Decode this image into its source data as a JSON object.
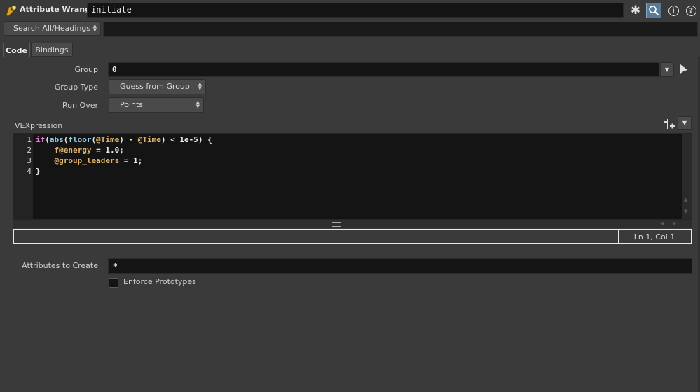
{
  "header": {
    "node_type": "Attribute Wrangle",
    "node_name": "initiate",
    "icons": [
      "node-wrangle-icon",
      "gear-icon",
      "search-icon",
      "info-icon",
      "help-icon"
    ]
  },
  "search": {
    "mode": "Search All/Headings",
    "value": ""
  },
  "tabs": [
    {
      "label": "Code",
      "active": true
    },
    {
      "label": "Bindings",
      "active": false
    }
  ],
  "params": {
    "group_label": "Group",
    "group_value": "0",
    "group_type_label": "Group Type",
    "group_type_value": "Guess from Group",
    "run_over_label": "Run Over",
    "run_over_value": "Points"
  },
  "vex": {
    "label": "VEXpression",
    "line_numbers": [
      "1",
      "2",
      "3",
      "4"
    ],
    "status": "Ln 1, Col 1"
  },
  "bottom": {
    "attrs_label": "Attributes to Create",
    "attrs_value": "*",
    "enforce_label": "Enforce Prototypes",
    "enforce_checked": false
  },
  "colors": {
    "background": "#3a3a3a",
    "field": "#151515",
    "accent": "#5a7a9a",
    "keyword": "#e67ad6",
    "function": "#8fd0e8",
    "attribute": "#e2b46a"
  }
}
